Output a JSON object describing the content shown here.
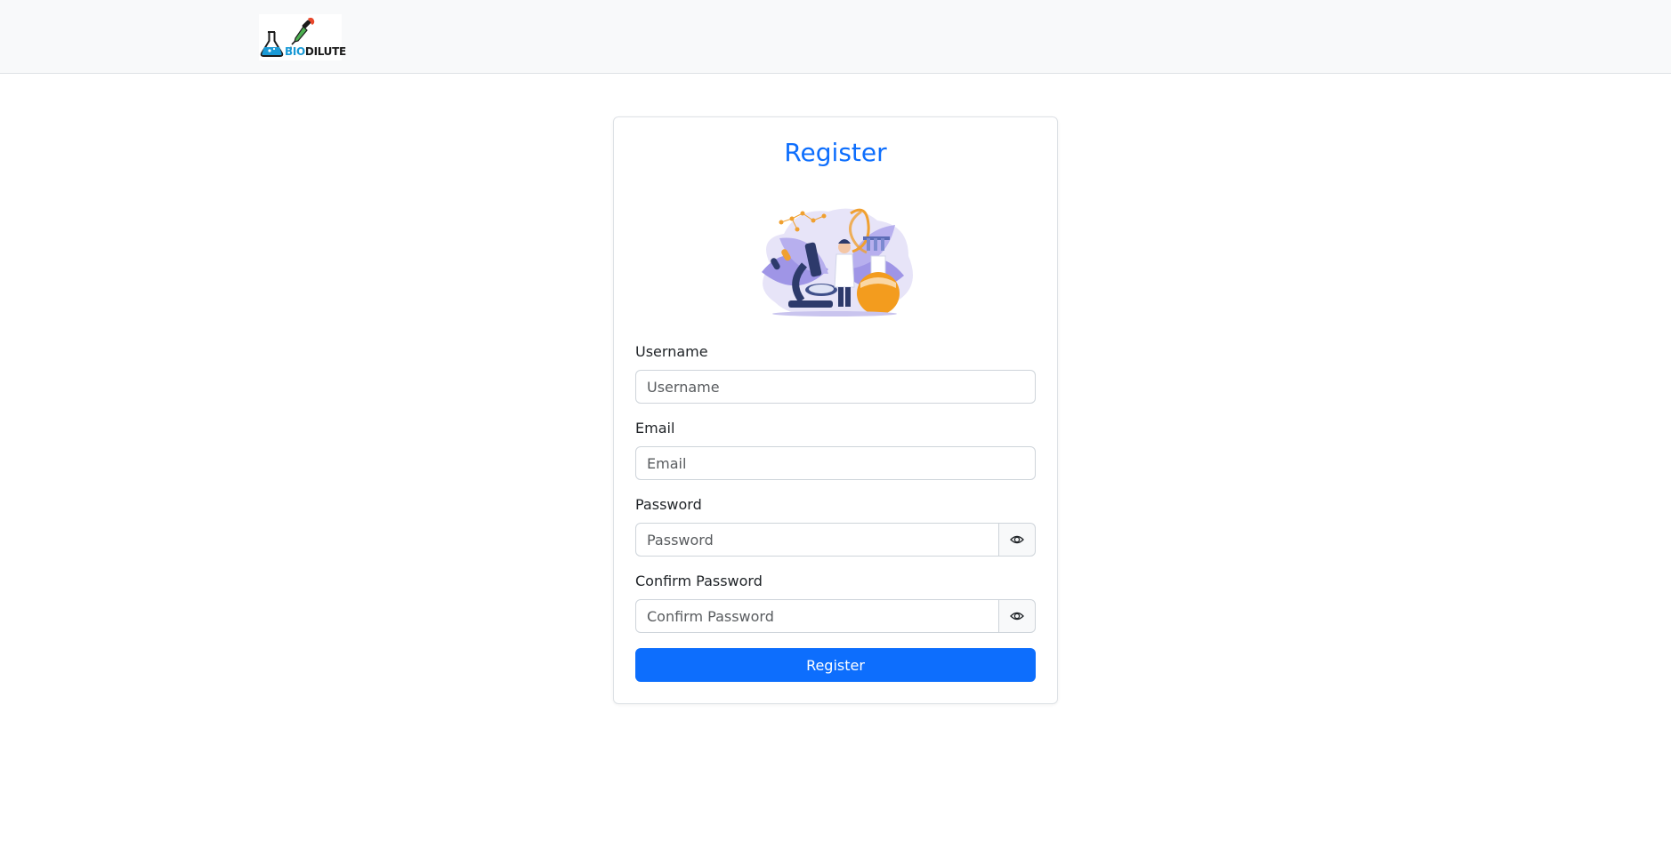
{
  "navbar": {
    "logo": {
      "part1": "BIO",
      "part2": "DILUTE",
      "icons": [
        "flask-icon",
        "dropper-icon"
      ]
    }
  },
  "form": {
    "title": "Register",
    "illustration": "scientist-lab-illustration",
    "fields": {
      "username": {
        "label": "Username",
        "placeholder": "Username",
        "value": ""
      },
      "email": {
        "label": "Email",
        "placeholder": "Email",
        "value": ""
      },
      "password": {
        "label": "Password",
        "placeholder": "Password",
        "value": "",
        "toggle_icon": "eye-icon"
      },
      "confirm_password": {
        "label": "Confirm Password",
        "placeholder": "Confirm Password",
        "value": "",
        "toggle_icon": "eye-icon"
      }
    },
    "submit_label": "Register"
  },
  "colors": {
    "primary": "#0d6efd",
    "navbar_bg": "#f8f9fa",
    "logo_blue": "#1a9ad6"
  }
}
